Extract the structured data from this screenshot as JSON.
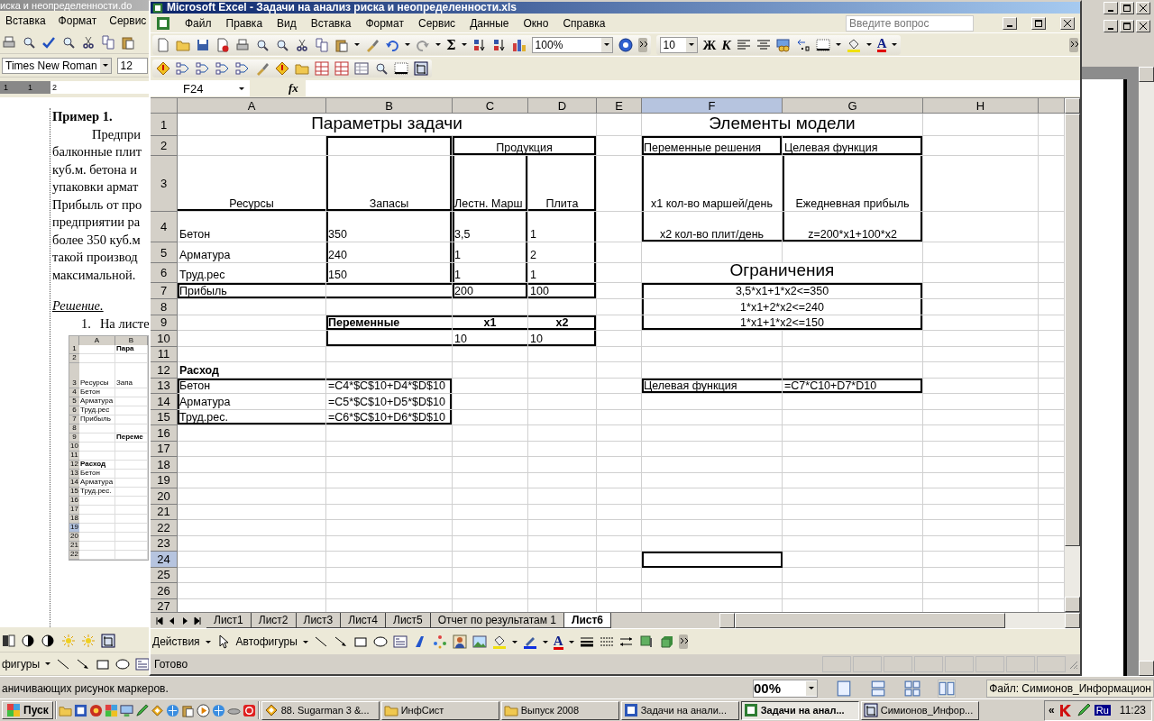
{
  "word_window": {
    "title": "иска и неопределенности.do",
    "menu": [
      "Вставка",
      "Формат",
      "Сервис"
    ],
    "font": "Times New Roman",
    "font_size": "12",
    "ruler": [
      "1",
      "1",
      "2"
    ],
    "document": {
      "heading": "Пример 1.",
      "lines": [
        "Предпри",
        "балконные плит",
        "куб.м. бетона и",
        "упаковки армат",
        "Прибыль от про",
        "предприятии ра",
        "более 350 куб.м",
        "такой производ",
        "максимальной."
      ],
      "solution": "Решение.",
      "list_item": {
        "number": "1.",
        "text": "На листе"
      }
    },
    "embedded_sheet": {
      "columns": [
        "A",
        "B"
      ],
      "rows": [
        {
          "label": "1",
          "selected": false,
          "cells": [
            "",
            {
              "text": "Пара",
              "bold": true
            }
          ]
        },
        {
          "label": "2",
          "selected": false,
          "cells": [
            "",
            ""
          ]
        },
        {
          "label": "3",
          "selected": false,
          "cells": [
            {
              "text": "Ресурсы",
              "bold": false
            },
            {
              "text": "Запа",
              "bold": false
            }
          ]
        },
        {
          "label": "4",
          "selected": false,
          "cells": [
            {
              "text": "Бетон",
              "bold": false
            },
            ""
          ]
        },
        {
          "label": "5",
          "selected": false,
          "cells": [
            {
              "text": "Арматура",
              "bold": false
            },
            ""
          ]
        },
        {
          "label": "6",
          "selected": false,
          "cells": [
            {
              "text": "Труд.рес",
              "bold": false
            },
            ""
          ]
        },
        {
          "label": "7",
          "selected": false,
          "cells": [
            {
              "text": "Прибыль",
              "bold": false
            },
            ""
          ]
        },
        {
          "label": "8",
          "selected": false,
          "cells": [
            "",
            ""
          ]
        },
        {
          "label": "9",
          "selected": false,
          "cells": [
            "",
            {
              "text": "Переме",
              "bold": true
            }
          ]
        },
        {
          "label": "10",
          "selected": false,
          "cells": [
            "",
            ""
          ]
        },
        {
          "label": "11",
          "selected": false,
          "cells": [
            "",
            ""
          ]
        },
        {
          "label": "12",
          "selected": false,
          "cells": [
            {
              "text": "Расход",
              "bold": true
            },
            ""
          ]
        },
        {
          "label": "13",
          "selected": false,
          "cells": [
            {
              "text": "Бетон",
              "bold": false
            },
            ""
          ]
        },
        {
          "label": "14",
          "selected": false,
          "cells": [
            {
              "text": "Арматура",
              "bold": false
            },
            ""
          ]
        },
        {
          "label": "15",
          "selected": false,
          "cells": [
            {
              "text": "Труд.рес.",
              "bold": false
            },
            ""
          ]
        },
        {
          "label": "16",
          "selected": false,
          "cells": [
            "",
            ""
          ]
        },
        {
          "label": "17",
          "selected": false,
          "cells": [
            "",
            ""
          ]
        },
        {
          "label": "18",
          "selected": false,
          "cells": [
            "",
            ""
          ]
        },
        {
          "label": "19",
          "selected": true,
          "cells": [
            "",
            ""
          ]
        },
        {
          "label": "20",
          "selected": false,
          "cells": [
            "",
            ""
          ]
        },
        {
          "label": "21",
          "selected": false,
          "cells": [
            "",
            ""
          ]
        },
        {
          "label": "22",
          "selected": false,
          "cells": [
            "",
            ""
          ]
        }
      ]
    },
    "drawing_menu": "фигуры",
    "status": "аничивающих рисунок маркеров.",
    "zoom": "00%",
    "file_info": "Файл: Симионов_Информацион"
  },
  "excel": {
    "title": "Microsoft Excel - Задачи на анализ риска и неопределенности.xls",
    "menu": [
      "Файл",
      "Правка",
      "Вид",
      "Вставка",
      "Формат",
      "Сервис",
      "Данные",
      "Окно",
      "Справка"
    ],
    "question": {
      "placeholder": "Введите вопрос"
    },
    "toolbar": {
      "sum": "Σ",
      "zoom": "100%",
      "font_size": "10",
      "bold": "Ж",
      "italic": "К",
      "font_color": "A"
    },
    "name_box": "F24",
    "fx": "fx",
    "columns": [
      {
        "label": "A",
        "selected": false
      },
      {
        "label": "B",
        "selected": false
      },
      {
        "label": "C",
        "selected": false
      },
      {
        "label": "D",
        "selected": false
      },
      {
        "label": "E",
        "selected": false
      },
      {
        "label": "F",
        "selected": true
      },
      {
        "label": "G",
        "selected": false
      },
      {
        "label": "H",
        "selected": false
      }
    ],
    "rows": [
      {
        "label": "1",
        "selected": false,
        "cells": [
          {
            "text": "Параметры задачи",
            "kind": "title",
            "centered": true,
            "colspan": 4
          },
          "",
          {
            "text": "Элементы модели",
            "kind": "title",
            "centered": true,
            "colspan": 2
          },
          ""
        ]
      },
      {
        "label": "2",
        "selected": false,
        "cells": [
          "",
          {
            "top": true,
            "left": true,
            "right": true
          },
          {
            "text": "Продукция",
            "centered": true,
            "colspan": 2,
            "top": true,
            "left": true,
            "right": true,
            "bottom": true
          },
          "",
          {
            "text": "Переменные решения",
            "top": true,
            "left": true,
            "right": true,
            "bottom": true
          },
          {
            "text": "Целевая функция",
            "top": true,
            "right": true,
            "bottom": true
          },
          ""
        ]
      },
      {
        "label": "3",
        "selected": false,
        "cells": [
          {
            "text": "Ресурсы",
            "centered": true,
            "bottom": true
          },
          {
            "text": "Запасы",
            "centered": true,
            "left": true,
            "right": true,
            "bottom": true
          },
          {
            "text": "Лестн. Марш",
            "left": true,
            "right": true,
            "bottom": true
          },
          {
            "text": "Плита",
            "centered": true,
            "right": true,
            "bottom": true
          },
          "",
          {
            "text": "x1 кол-во маршей/день",
            "centered": true,
            "left": true
          },
          {
            "text": "Ежедневная прибыль",
            "centered": true,
            "left": true,
            "right": true
          },
          ""
        ]
      },
      {
        "label": "4",
        "selected": false,
        "cells": [
          {
            "text": "Бетон"
          },
          {
            "text": "350",
            "left": true,
            "right": true
          },
          {
            "text": "3,5",
            "left": true,
            "right": true
          },
          {
            "text": "1",
            "right": true
          },
          "",
          {
            "text": "x2 кол-во плит/день",
            "centered": true,
            "left": true,
            "bottom": true
          },
          {
            "text": "z=200*x1+100*x2",
            "centered": true,
            "left": true,
            "right": true,
            "bottom": true
          },
          ""
        ]
      },
      {
        "label": "5",
        "selected": false,
        "cells": [
          {
            "text": "Арматура"
          },
          {
            "text": "240",
            "left": true,
            "right": true
          },
          {
            "text": "1",
            "left": true,
            "right": true
          },
          {
            "text": "2",
            "right": true
          },
          "",
          "",
          "",
          ""
        ]
      },
      {
        "label": "6",
        "selected": false,
        "cells": [
          {
            "text": "Труд.рес"
          },
          {
            "text": "150",
            "left": true,
            "right": true
          },
          {
            "text": "1",
            "left": true,
            "right": true
          },
          {
            "text": "1",
            "right": true
          },
          "",
          {
            "text": "Ограничения",
            "kind": "title",
            "centered": true,
            "colspan": 2
          },
          ""
        ]
      },
      {
        "label": "7",
        "selected": false,
        "cells": [
          {
            "text": "Прибыль",
            "top": true,
            "bottom": true,
            "left": true
          },
          {
            "top": true,
            "bottom": true
          },
          {
            "text": "200",
            "top": true,
            "bottom": true,
            "left": true,
            "right": true
          },
          {
            "text": "100",
            "top": true,
            "bottom": true,
            "right": true
          },
          "",
          {
            "text": "3,5*x1+1*x2<=350",
            "centered": true,
            "colspan": 2,
            "top": true,
            "left": true,
            "right": true
          },
          ""
        ]
      },
      {
        "label": "8",
        "selected": false,
        "cells": [
          "",
          "",
          "",
          "",
          "",
          {
            "text": "1*x1+2*x2<=240",
            "centered": true,
            "colspan": 2,
            "left": true,
            "right": true
          },
          ""
        ]
      },
      {
        "label": "9",
        "selected": false,
        "cells": [
          "",
          {
            "text": "Переменные",
            "bold": true,
            "top": true,
            "left": true,
            "bottom": true
          },
          {
            "text": "x1",
            "bold": true,
            "centered": true,
            "top": true,
            "bottom": true
          },
          {
            "text": "x2",
            "bold": true,
            "centered": true,
            "top": true,
            "bottom": true,
            "right": true
          },
          "",
          {
            "text": "1*x1+1*x2<=150",
            "centered": true,
            "colspan": 2,
            "left": true,
            "right": true,
            "bottom": true
          },
          ""
        ]
      },
      {
        "label": "10",
        "selected": false,
        "cells": [
          "",
          {
            "left": true,
            "bottom": true
          },
          {
            "text": "10",
            "bottom": true
          },
          {
            "text": "10",
            "right": true,
            "bottom": true
          },
          "",
          "",
          "",
          ""
        ]
      },
      {
        "label": "11",
        "selected": false,
        "cells": [
          "",
          "",
          "",
          "",
          "",
          "",
          "",
          ""
        ]
      },
      {
        "label": "12",
        "selected": false,
        "cells": [
          {
            "text": "Расход",
            "bold": true
          },
          "",
          "",
          "",
          "",
          "",
          "",
          ""
        ]
      },
      {
        "label": "13",
        "selected": false,
        "cells": [
          {
            "text": "Бетон",
            "top": true,
            "left": true
          },
          {
            "text": "=C4*$C$10+D4*$D$10",
            "top": true,
            "right": true
          },
          "",
          "",
          "",
          {
            "text": "Целевая функция",
            "top": true,
            "left": true,
            "bottom": true
          },
          {
            "text": "=C7*C10+D7*D10",
            "top": true,
            "right": true,
            "bottom": true
          },
          ""
        ]
      },
      {
        "label": "14",
        "selected": false,
        "cells": [
          {
            "text": "Арматура",
            "left": true
          },
          {
            "text": "=C5*$C$10+D5*$D$10",
            "right": true
          },
          "",
          "",
          "",
          "",
          "",
          ""
        ]
      },
      {
        "label": "15",
        "selected": false,
        "cells": [
          {
            "text": "Труд.рес.",
            "left": true,
            "bottom": true
          },
          {
            "text": "=C6*$C$10+D6*$D$10",
            "right": true,
            "bottom": true
          },
          "",
          "",
          "",
          "",
          "",
          ""
        ]
      },
      {
        "label": "16",
        "selected": false,
        "cells": [
          "",
          "",
          "",
          "",
          "",
          "",
          "",
          ""
        ]
      },
      {
        "label": "17",
        "selected": false,
        "cells": [
          "",
          "",
          "",
          "",
          "",
          "",
          "",
          ""
        ]
      },
      {
        "label": "18",
        "selected": false,
        "cells": [
          "",
          "",
          "",
          "",
          "",
          "",
          "",
          ""
        ]
      },
      {
        "label": "19",
        "selected": false,
        "cells": [
          "",
          "",
          "",
          "",
          "",
          "",
          "",
          ""
        ]
      },
      {
        "label": "20",
        "selected": false,
        "cells": [
          "",
          "",
          "",
          "",
          "",
          "",
          "",
          ""
        ]
      },
      {
        "label": "21",
        "selected": false,
        "cells": [
          "",
          "",
          "",
          "",
          "",
          "",
          "",
          ""
        ]
      },
      {
        "label": "22",
        "selected": false,
        "cells": [
          "",
          "",
          "",
          "",
          "",
          "",
          "",
          ""
        ]
      },
      {
        "label": "23",
        "selected": false,
        "cells": [
          "",
          "",
          "",
          "",
          "",
          "",
          "",
          ""
        ]
      },
      {
        "label": "24",
        "selected": true,
        "cells": [
          "",
          "",
          "",
          "",
          "",
          "",
          "",
          ""
        ]
      },
      {
        "label": "25",
        "selected": false,
        "cells": [
          "",
          "",
          "",
          "",
          "",
          "",
          "",
          ""
        ]
      },
      {
        "label": "26",
        "selected": false,
        "cells": [
          "",
          "",
          "",
          "",
          "",
          "",
          "",
          ""
        ]
      },
      {
        "label": "27",
        "selected": false,
        "cells": [
          "",
          "",
          "",
          "",
          "",
          "",
          "",
          ""
        ]
      }
    ],
    "sheet_tabs": [
      {
        "label": "Лист1",
        "selected": false
      },
      {
        "label": "Лист2",
        "selected": false
      },
      {
        "label": "Лист3",
        "selected": false
      },
      {
        "label": "Лист4",
        "selected": false
      },
      {
        "label": "Лист5",
        "selected": false
      },
      {
        "label": "Отчет по результатам 1",
        "selected": false
      },
      {
        "label": "Лист6",
        "selected": true
      }
    ],
    "drawing_toolbar": {
      "actions": "Действия",
      "autoshapes": "Автофигуры",
      "font_color": "A"
    },
    "status": "Готово"
  },
  "taskbar": {
    "start": "Пуск",
    "buttons": [
      {
        "label": "88. Sugarman 3 &...",
        "selected": false
      },
      {
        "label": "ИнфСист",
        "selected": false
      },
      {
        "label": "Выпуск 2008",
        "selected": false
      },
      {
        "label": "Задачи на анали...",
        "selected": false
      },
      {
        "label": "Задачи на анал...",
        "selected": true
      },
      {
        "label": "Симионов_Инфор...",
        "selected": false
      }
    ],
    "tray_chevron": "«",
    "language": "Ru",
    "clock": "11:23"
  }
}
